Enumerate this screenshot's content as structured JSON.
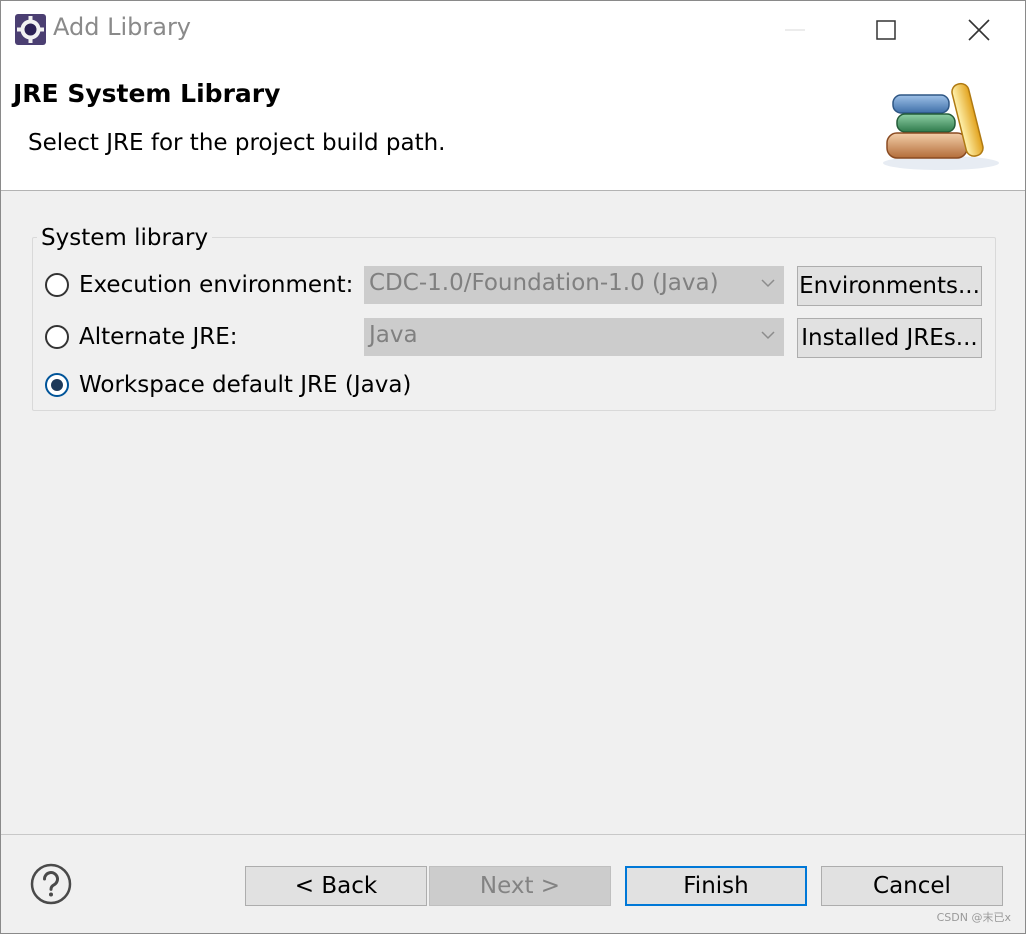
{
  "window": {
    "title": "Add Library"
  },
  "banner": {
    "title": "JRE System Library",
    "message": "Select JRE for the project build path."
  },
  "group": {
    "label": "System library",
    "options": [
      {
        "label": "Execution environment:",
        "selected": false,
        "combo_value": "CDC-1.0/Foundation-1.0 (Java)",
        "button": "Environments..."
      },
      {
        "label": "Alternate JRE:",
        "selected": false,
        "combo_value": "Java",
        "button": "Installed JREs..."
      },
      {
        "label": "Workspace default JRE (Java)",
        "selected": true
      }
    ]
  },
  "footer": {
    "back": "< Back",
    "next": "Next >",
    "finish": "Finish",
    "cancel": "Cancel"
  },
  "watermark": "CSDN @末已x",
  "icons": {
    "app": "eclipse-gear-icon",
    "minimize": "minimize-icon",
    "maximize": "maximize-icon",
    "close": "close-icon",
    "banner": "library-books-icon",
    "help": "help-icon",
    "dropdown": "chevron-down-icon"
  },
  "colors": {
    "dialog_bg": "#f0f0f0",
    "disabled_field": "#cccccc",
    "default_button_border": "#0078d7",
    "radio_dot": "#1e3a5a"
  }
}
